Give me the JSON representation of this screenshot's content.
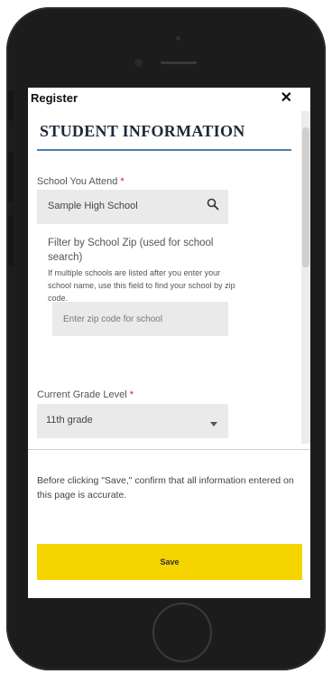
{
  "dialog": {
    "title": "Register",
    "close_glyph": "✕"
  },
  "section": {
    "title": "STUDENT INFORMATION"
  },
  "school": {
    "label": "School You Attend",
    "required_mark": "*",
    "value": "Sample High School",
    "icon": "search-icon"
  },
  "zip_filter": {
    "help_title": "Filter by School Zip (used for school search)",
    "help_text": "If multiple schools are listed after you enter your school name, use this field to find your school by zip code.",
    "placeholder": "Enter zip code for school"
  },
  "grade": {
    "label": "Current Grade Level",
    "required_mark": "*",
    "selected": "11th grade",
    "icon": "chevron-down-icon"
  },
  "confirm_text": "Before clicking \"Save,\" confirm that all information entered on this page is accurate.",
  "save_label": "Save",
  "colors": {
    "accent_rule": "#4a7fb0",
    "save_button": "#f5d400",
    "required": "#cc2222"
  }
}
